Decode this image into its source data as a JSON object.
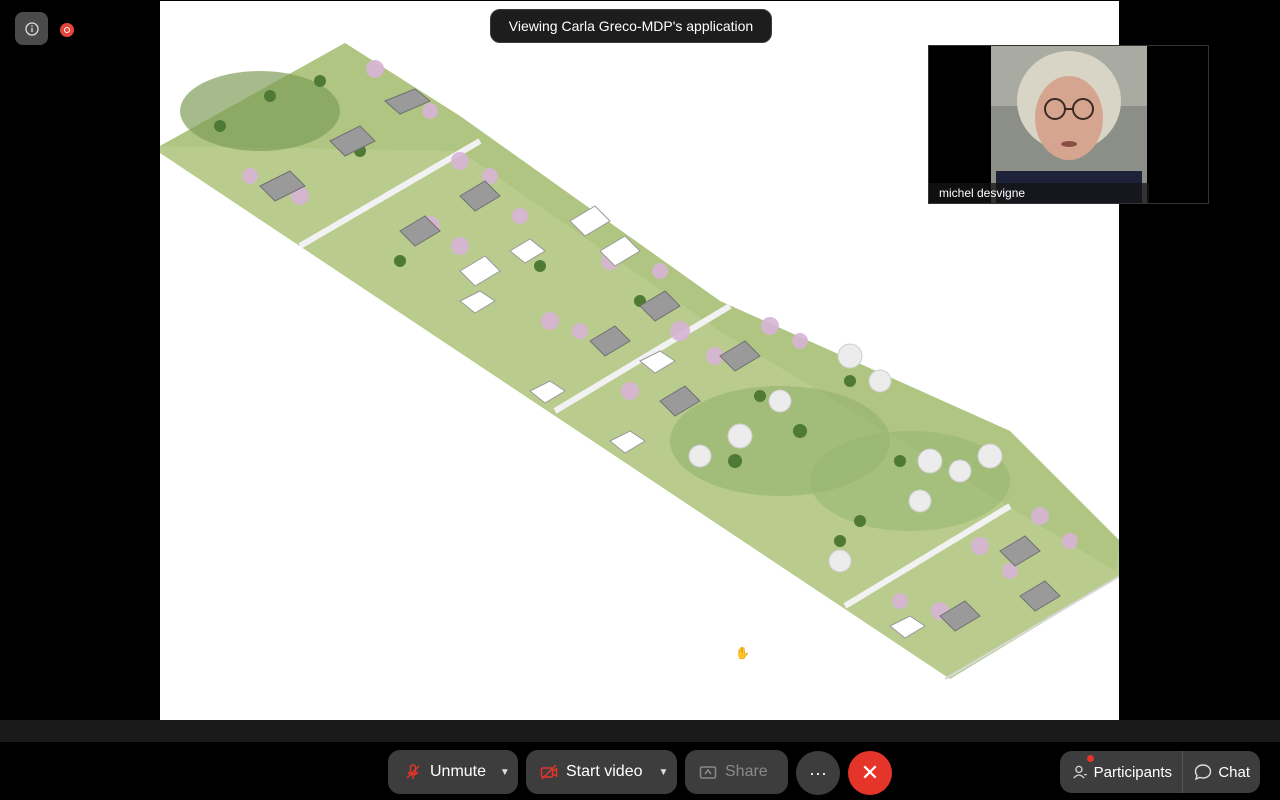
{
  "banner": {
    "text": "Viewing Carla Greco-MDP's application"
  },
  "participant": {
    "name": "michel desvigne"
  },
  "toolbar": {
    "unmute_label": "Unmute",
    "start_video_label": "Start video",
    "share_label": "Share",
    "more_label": "···",
    "leave_label": "✕",
    "participants_label": "Participants",
    "chat_label": "Chat"
  },
  "icons": {
    "info": "info-icon",
    "record": "recording-icon",
    "mic": "mic-muted-icon",
    "video": "video-off-icon",
    "share": "share-icon",
    "participants": "participants-icon",
    "chat": "chat-icon"
  },
  "colors": {
    "leave": "#e5352b",
    "recording": "#e8453c",
    "button_bg": "#3d3d3d",
    "grass": "#a8c27a",
    "blossom": "#d8b4d6"
  }
}
